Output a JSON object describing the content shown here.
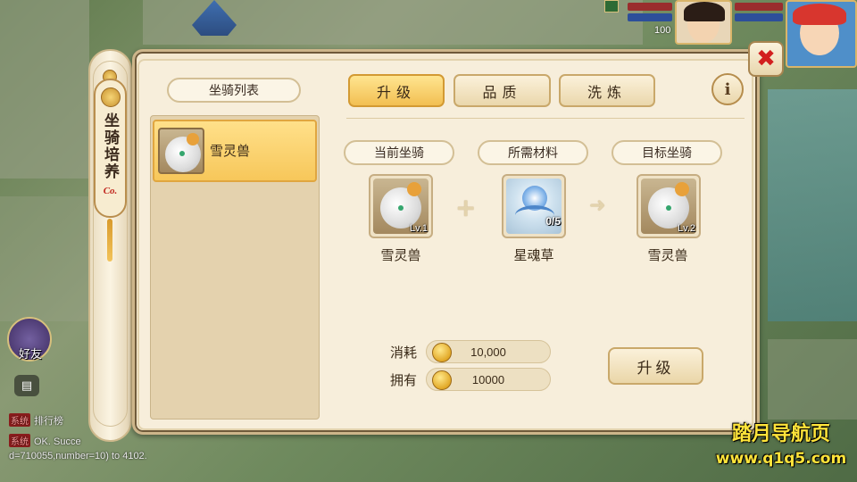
{
  "hud": {
    "player_level": "100"
  },
  "scroll": {
    "title": "坐骑培养",
    "seal": "Co."
  },
  "list": {
    "heading": "坐骑列表",
    "items": [
      {
        "name": "雪灵兽",
        "selected": true
      }
    ]
  },
  "tabs": [
    {
      "label": "升级",
      "active": true
    },
    {
      "label": "品质",
      "active": false
    },
    {
      "label": "洗炼",
      "active": false
    }
  ],
  "info_icon": "i",
  "close_icon": "✖",
  "sections": {
    "current": "当前坐骑",
    "material": "所需材料",
    "target": "目标坐骑"
  },
  "current_mount": {
    "name": "雪灵兽",
    "level": "Lv.1"
  },
  "material": {
    "name": "星魂草",
    "count": "0/5"
  },
  "target_mount": {
    "name": "雪灵兽",
    "level": "Lv.2"
  },
  "cost": {
    "consume_label": "消耗",
    "consume_value": "10,000",
    "own_label": "拥有",
    "own_value": "10000"
  },
  "upgrade_button": "升级",
  "hud_left": {
    "friend_label": "好友",
    "chat_icon": "chat-bubble-icon"
  },
  "chat": [
    {
      "tag": "系统",
      "text": "排行榜"
    },
    {
      "tag": "系统",
      "text": "OK. Succe"
    },
    {
      "tag": "",
      "text": "d=710055,number=10) to 4102."
    }
  ],
  "watermark": {
    "title": "踏月导航页",
    "url": "www.q1q5.com"
  },
  "colors": {
    "accent_gold": "#f2bf52",
    "close_red": "#d21f1f",
    "panel_bg": "#f4e9d0",
    "watermark_yellow": "#ffe43a"
  }
}
